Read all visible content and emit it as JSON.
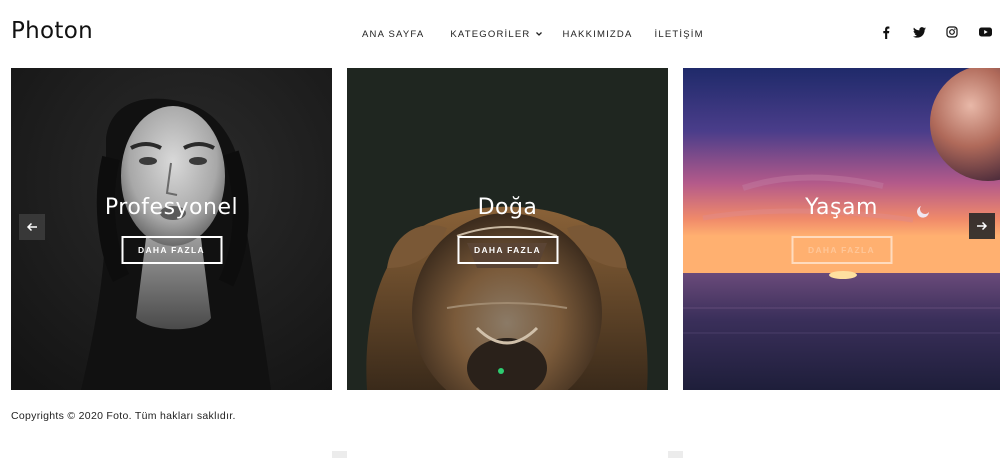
{
  "header": {
    "logo": "Photon",
    "nav": [
      {
        "label": "ANA SAYFA"
      },
      {
        "label": "KATEGORİLER",
        "has_dropdown": true
      },
      {
        "label": "HAKKIMIZDA"
      },
      {
        "label": "İLETİŞİM"
      }
    ],
    "social": [
      "facebook-icon",
      "twitter-icon",
      "instagram-icon",
      "youtube-icon"
    ]
  },
  "slider": {
    "slides": [
      {
        "title": "Profesyonel",
        "button": "DAHA FAZLA",
        "image": "portrait-woman"
      },
      {
        "title": "Doğa",
        "button": "DAHA FAZLA",
        "image": "lion-face"
      },
      {
        "title": "Yaşam",
        "button": "DAHA FAZLA",
        "image": "sunset-sea-planet"
      }
    ],
    "prev_icon": "arrow-left-icon",
    "next_icon": "arrow-right-icon",
    "active_dot_color": "#2ecc71"
  },
  "footer": {
    "text": "Copyrights © 2020 Foto. Tüm hakları saklıdır."
  }
}
